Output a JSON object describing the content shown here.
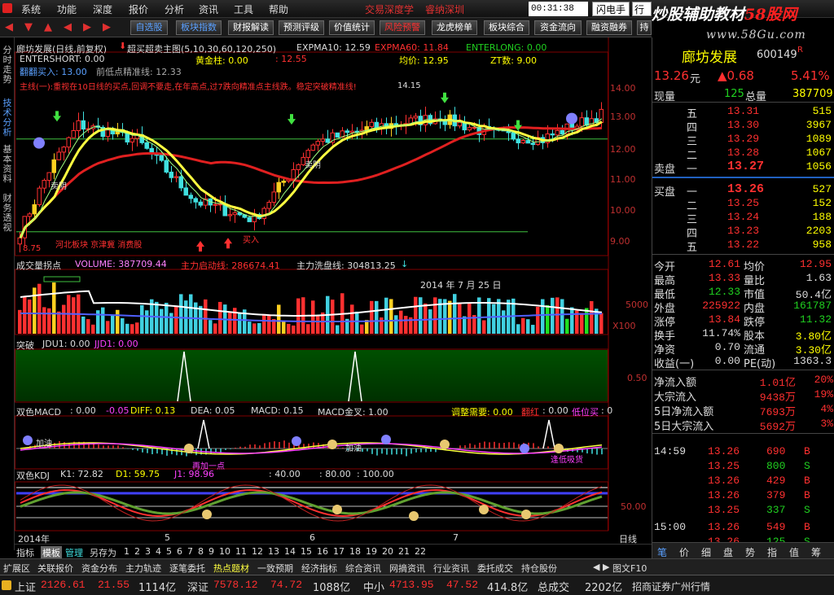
{
  "menu": {
    "items": [
      "系统",
      "功能",
      "深度",
      "报价",
      "分析",
      "资讯",
      "工具",
      "帮助"
    ],
    "ads": [
      "交易深度学",
      "睿纳深圳"
    ],
    "clock": "00:31:38 周一",
    "flash": "闪电手",
    "trade": "行情"
  },
  "watermark": {
    "line1a": "炒股辅助教材",
    "line1b": "58股网",
    "line2": "www.58Gu.com"
  },
  "toolbar": {
    "items": [
      "自选股",
      "板块指数",
      "财报解读",
      "预测评级",
      "价值统计",
      "风险预警",
      "龙虎榜单",
      "板块综合",
      "资金流向",
      "融资融券",
      "持"
    ]
  },
  "leftrail": {
    "tabs": [
      "分时走势",
      "技术分析",
      "基本资料",
      "财务透视"
    ]
  },
  "main": {
    "title": "廊坊发展(日线,前复权)",
    "indicator_title": "超买超卖主图(5,10,30,60,120,250)",
    "expma10": "EXPMA10: 12.59",
    "expma60": "EXPMA60: 11.84",
    "enterlong": "ENTERLONG: 0.00",
    "entershort": "ENTERSHORT: 0.00",
    "gold": "黄金柱: 0.00",
    "red_val": ": 12.55",
    "avg": "均价: 12.95",
    "zt": "ZT数: 9.00",
    "jg": "翻翻买入: 13.00",
    "qd": "前低点精准线: 12.33",
    "ann_banner": "主线(一):重视在10日线的买点,回调不要走,在年高点,过7跌向精准点主线跌。稳定突破精准线!",
    "ann_1415": "14.15",
    "low_label": "8.75",
    "note_sector": "河北板块 京津冀 消费股",
    "buy_label": "买入",
    "sell_label": "卖阴",
    "buy2": "卖阴",
    "yaxis": [
      "14.00",
      "13.00",
      "12.00",
      "11.00",
      "10.00",
      "9.00"
    ]
  },
  "vol": {
    "title": "成交量拐点",
    "volume": "VOLUME: 387709.44",
    "zl": "主力启动线: 286674.41",
    "xp": "主力洗盘线: 304813.25",
    "date": "2014 年 7 月 25 日",
    "y1": "5000",
    "y2": "X100"
  },
  "tp": {
    "title": "突破",
    "jdu1": "JDU1: 0.00",
    "jjd1": "JJD1: 0.00",
    "y": "0.50"
  },
  "macd": {
    "title": "双色MACD",
    "v0": ": 0.00",
    "v1": "-0.05",
    "diff": "DIFF: 0.13",
    "dea": "DEA: 0.05",
    "macd": "MACD: 0.15",
    "cross": "MACD金叉: 1.00",
    "adj": "调整需要: 0.00",
    "red": "翻红",
    "redv": ": 0.00",
    "lowbuy": "低位买",
    "lowv": ": 0",
    "ann1": "加油",
    "ann2": "加油",
    "ann3": "再加一点",
    "ann4": "逢低吸货"
  },
  "kdj": {
    "title": "双色KDJ",
    "k": "K1: 72.82",
    "d": "D1: 59.75",
    "j": "J1: 98.96",
    "v40": ": 40.00",
    "v80": ": 80.00",
    "v100": ": 100.00",
    "y": "50.00"
  },
  "xaxis": {
    "labels": [
      "2014年",
      "5",
      "6",
      "7"
    ],
    "right": "日线"
  },
  "bottomtabs": {
    "items": [
      "指标",
      "模板",
      "管理",
      "另存为",
      "1",
      "2",
      "3",
      "4",
      "5",
      "6",
      "7",
      "8",
      "9",
      "10",
      "11",
      "12",
      "13",
      "14",
      "15",
      "16",
      "17",
      "18",
      "19",
      "20",
      "21",
      "22"
    ]
  },
  "funcbar": {
    "items": [
      "扩展区",
      "关联报价",
      "资金分布",
      "主力轨迹",
      "逐笔委托",
      "热点题材",
      "一致预期",
      "经济指标",
      "综合资讯",
      "网摘资讯",
      "行业资讯",
      "委托成交",
      "持仓股份"
    ],
    "right": "图文F10"
  },
  "rp_tabs": [
    "笔",
    "价",
    "细",
    "盘",
    "势",
    "指",
    "值",
    "筹"
  ],
  "quote": {
    "name": "廊坊发展",
    "code": "600149",
    "flag": "R",
    "price": "13.26",
    "price_unit": "元",
    "change": "▲0.68",
    "pct": "5.41%",
    "xianliang_label": "现量",
    "xianliang": "125",
    "zongliang_label": "总量",
    "zongliang": "387709",
    "sell_label": "卖盘",
    "buy_label": "买盘",
    "asks": [
      {
        "lvl": "五",
        "price": "13.31",
        "vol": "515"
      },
      {
        "lvl": "四",
        "price": "13.30",
        "vol": "3967"
      },
      {
        "lvl": "三",
        "price": "13.29",
        "vol": "1089"
      },
      {
        "lvl": "二",
        "price": "13.28",
        "vol": "1067"
      },
      {
        "lvl": "一",
        "price": "13.27",
        "vol": "1056"
      }
    ],
    "bids": [
      {
        "lvl": "一",
        "price": "13.26",
        "vol": "527"
      },
      {
        "lvl": "二",
        "price": "13.25",
        "vol": "152"
      },
      {
        "lvl": "三",
        "price": "13.24",
        "vol": "188"
      },
      {
        "lvl": "四",
        "price": "13.23",
        "vol": "2203"
      },
      {
        "lvl": "五",
        "price": "13.22",
        "vol": "958"
      }
    ],
    "stats": [
      {
        "l1": "今开",
        "v1": "12.61",
        "l2": "均价",
        "v2": "12.95"
      },
      {
        "l1": "最高",
        "v1": "13.33",
        "l2": "量比",
        "v2": "1.63"
      },
      {
        "l1": "最低",
        "v1": "12.33",
        "l2": "市值",
        "v2": "50.4亿"
      },
      {
        "l1": "外盘",
        "v1": "225922",
        "l2": "内盘",
        "v2": "161787"
      },
      {
        "l1": "涨停",
        "v1": "13.84",
        "l2": "跌停",
        "v2": "11.32"
      },
      {
        "l1": "换手",
        "v1": "11.74%",
        "l2": "股本",
        "v2": "3.80亿"
      },
      {
        "l1": "净资",
        "v1": "0.70",
        "l2": "流通",
        "v2": "3.30亿"
      },
      {
        "l1": "收益(一)",
        "v1": "0.00",
        "l2": "PE(动)",
        "v2": "1363.3"
      }
    ],
    "flows": [
      {
        "l": "净流入额",
        "v": "1.01亿",
        "p": "20%"
      },
      {
        "l": "大宗流入",
        "v": "9438万",
        "p": "19%"
      },
      {
        "l": "5日净流入额",
        "v": "7693万",
        "p": "4%"
      },
      {
        "l": "5日大宗流入",
        "v": "5692万",
        "p": "3%"
      }
    ],
    "ticks": [
      {
        "t": "14:59",
        "p": "13.26",
        "v": "690",
        "s": "B"
      },
      {
        "t": "",
        "p": "13.25",
        "v": "800",
        "s": "S"
      },
      {
        "t": "",
        "p": "13.26",
        "v": "429",
        "s": "B"
      },
      {
        "t": "",
        "p": "13.26",
        "v": "379",
        "s": "B"
      },
      {
        "t": "",
        "p": "13.25",
        "v": "337",
        "s": "S"
      },
      {
        "t": "15:00",
        "p": "13.26",
        "v": "549",
        "s": "B"
      },
      {
        "t": "",
        "p": "13.26",
        "v": "125",
        "s": "S"
      }
    ]
  },
  "status": {
    "sh_label": "上证",
    "sh": "2126.61",
    "sh_chg": "21.55",
    "sh_amt": "1114亿",
    "sz_label": "深证",
    "sz": "7578.12",
    "sz_chg": "74.72",
    "sz_amt": "1088亿",
    "zx_label": "中小",
    "zx": "4713.95",
    "zx_chg": "47.52",
    "zx_amt": "414.8亿",
    "total_label": "总成交",
    "total": "2202亿",
    "broker": "招商证券广州行情"
  },
  "colors": {
    "up": "#ff3030",
    "down": "#40e0e0",
    "ma_yellow": "#ffff40",
    "ma_red": "#e02020",
    "accent": "#5aa0ff"
  }
}
